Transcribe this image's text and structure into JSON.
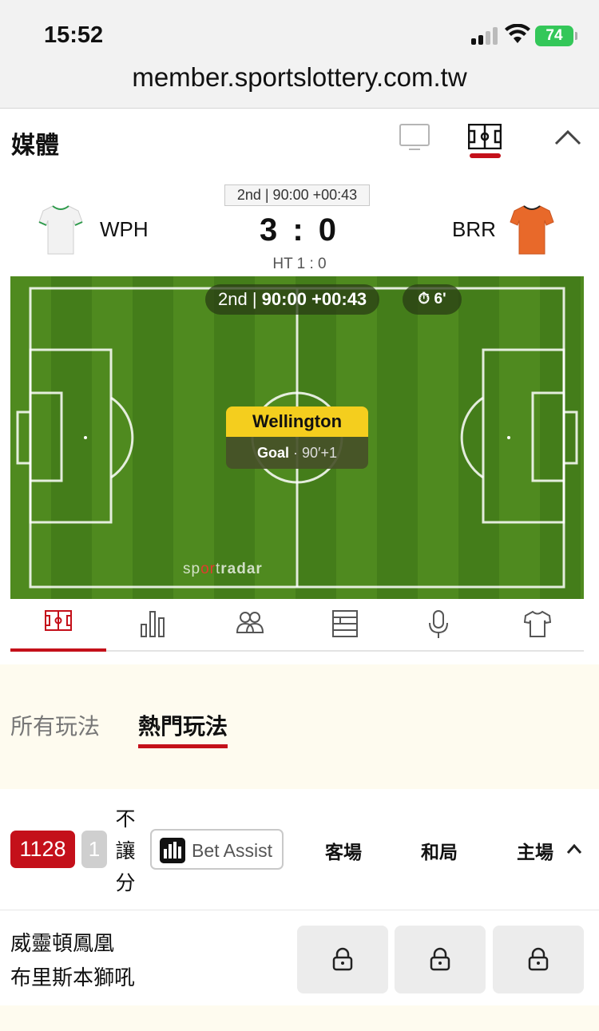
{
  "status_bar": {
    "time": "15:52",
    "battery": "74"
  },
  "browser": {
    "url": "member.sportslottery.com.tw"
  },
  "media": {
    "title": "媒體",
    "tabs": [
      "tv-icon",
      "pitch-icon"
    ],
    "active_tab": "pitch-icon"
  },
  "scoreboard": {
    "period_badge": "2nd | 90:00 +00:43",
    "home_code": "WPH",
    "away_code": "BRR",
    "score": "3 : 0",
    "halftime": "HT 1 : 0",
    "home_jersey_color": "#f2f2f2",
    "away_jersey_color": "#e8692a"
  },
  "pitch": {
    "period": "2nd",
    "clock": "90:00 +00:43",
    "timer": "6'",
    "event_team": "Wellington",
    "event_type": "Goal",
    "event_minute": "· 90′+1",
    "watermark_sport": "sp",
    "watermark_or": "or",
    "watermark_t": "t",
    "watermark_radar": "radar"
  },
  "icon_tabs": [
    "pitch-tab-icon",
    "stats-icon",
    "lineup-icon",
    "table-icon",
    "commentary-icon",
    "jersey-icon"
  ],
  "play_types": {
    "all": "所有玩法",
    "popular": "熱門玩法"
  },
  "market": {
    "match_count": "1128",
    "small_count": "1",
    "name_lines": [
      "不",
      "讓",
      "分"
    ],
    "bet_assist": "Bet Assist",
    "col_away": "客場",
    "col_draw": "和局",
    "col_home": "主場"
  },
  "match": {
    "team1": "威靈頓鳳凰",
    "team2": "布里斯本獅吼"
  },
  "colors": {
    "accent": "#c4101a",
    "pitch": "#4f8a1f",
    "goal_yellow": "#f4ce1e"
  }
}
